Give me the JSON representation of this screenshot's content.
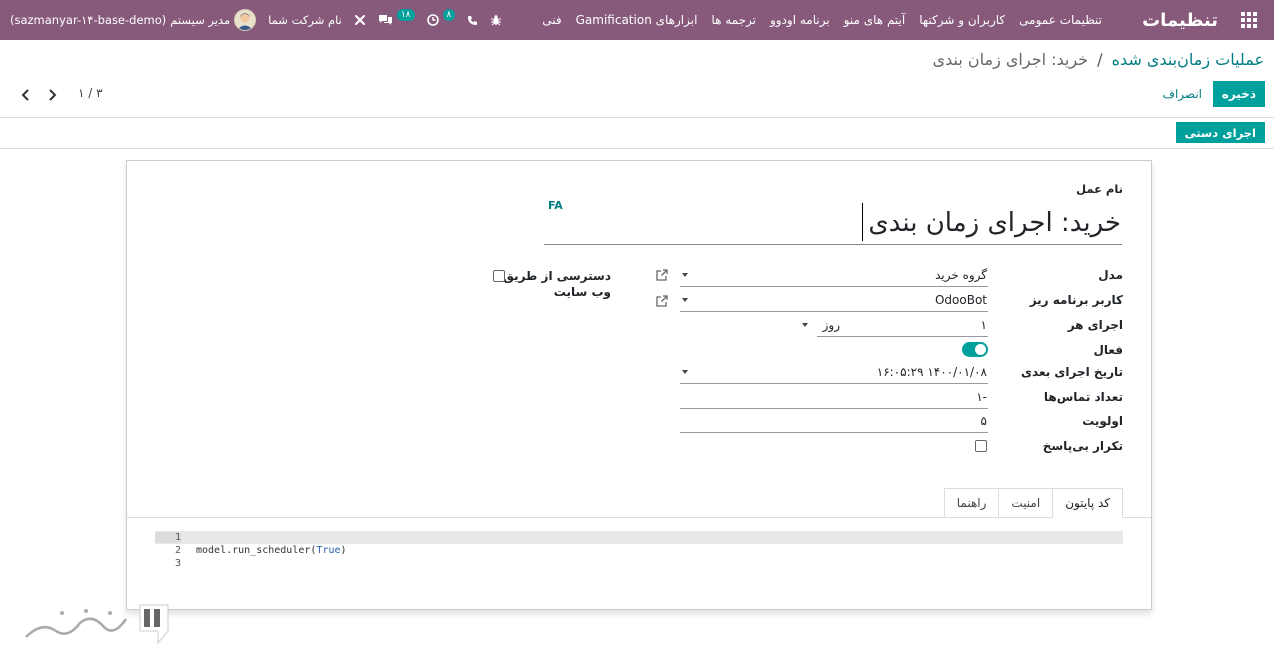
{
  "navbar": {
    "app_title": "تنظیمات",
    "menu": [
      "تنظیمات عمومی",
      "کاربران و شرکتها",
      "آیتم های منو",
      "برنامه اودوو",
      "ترجمه ها",
      "ابزارهای Gamification",
      "فنی"
    ],
    "company": "نام شرکت شما",
    "messages_count": "۱۸",
    "activities_count": "۸",
    "user": "مدیر سیستم",
    "database": "(sazmanyar-۱۴-base-demo)"
  },
  "breadcrumb": {
    "parent": "عملیات زمان‌بندی شده",
    "separator": "/",
    "current": "خرید: اجرای زمان بندی"
  },
  "actions": {
    "save": "ذخیره",
    "discard": "انصراف",
    "manual_run": "اجرای دستی"
  },
  "pager": {
    "value": "۱ / ۳"
  },
  "form": {
    "name_label": "نام عمل",
    "lang_badge": "FA",
    "name_value": "خرید: اجرای زمان بندی",
    "fields": {
      "model": {
        "label": "مدل",
        "value": "گروه خرید"
      },
      "scheduler_user": {
        "label": "کاربر برنامه ریز",
        "value": "OdooBot"
      },
      "interval": {
        "label": "اجرای هر",
        "number": "۱",
        "unit": "روز"
      },
      "active": {
        "label": "فعال",
        "value": true
      },
      "next_call": {
        "label": "تاریخ اجرای بعدی",
        "value": "۱۴۰۰/۰۱/۰۸ ۱۶:۰۵:۲۹"
      },
      "num_calls": {
        "label": "تعداد تماس‌ها",
        "value": "-۱"
      },
      "priority": {
        "label": "اولویت",
        "value": "۵"
      },
      "do_repeat": {
        "label": "تکرار بی‌پاسخ",
        "value": false
      }
    },
    "website_access": {
      "label": "دسترسی از طریق وب سایت",
      "value": false
    }
  },
  "tabs": [
    {
      "label": "کد پایتون",
      "active": true
    },
    {
      "label": "امنیت",
      "active": false
    },
    {
      "label": "راهنما",
      "active": false
    }
  ],
  "code": {
    "lines": [
      {
        "num": "1",
        "text": ""
      },
      {
        "num": "2",
        "text_plain": "model.run_scheduler(",
        "text_kw": "True",
        "text_end": ")"
      },
      {
        "num": "3",
        "text": ""
      }
    ]
  }
}
